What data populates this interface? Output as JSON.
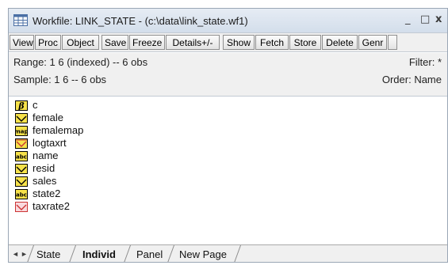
{
  "window": {
    "title": "Workfile: LINK_STATE - (c:\\data\\link_state.wf1)",
    "controls": {
      "minimize": "_",
      "maximize": "□",
      "close": "x"
    }
  },
  "toolbar": [
    "View",
    "Proc",
    "Object",
    "Save",
    "Freeze",
    "Details+/-",
    "Show",
    "Fetch",
    "Store",
    "Delete",
    "Genr"
  ],
  "info": {
    "range": "Range:  1 6 (indexed)  --  6 obs",
    "sample": "Sample: 1 6  --  6 obs",
    "filter": "Filter: *",
    "order": "Order: Name"
  },
  "objects": [
    {
      "name": "c",
      "icon": "coef-icon"
    },
    {
      "name": "female",
      "icon": "series-icon"
    },
    {
      "name": "femalemap",
      "icon": "map-icon"
    },
    {
      "name": "logtaxrt",
      "icon": "link-series-icon"
    },
    {
      "name": "name",
      "icon": "alpha-icon"
    },
    {
      "name": "resid",
      "icon": "series-icon"
    },
    {
      "name": "sales",
      "icon": "series-icon"
    },
    {
      "name": "state2",
      "icon": "alpha-icon"
    },
    {
      "name": "taxrate2",
      "icon": "link-series-red-icon"
    }
  ],
  "tabs": {
    "left_arrow": "◄",
    "right_arrow": "►",
    "items": [
      "State",
      "Individ",
      "Panel",
      "New Page"
    ],
    "active": "Individ"
  },
  "icon_glyphs": {
    "coef": "β",
    "map": "map",
    "alpha": "abc"
  },
  "colors": {
    "series_yellow": "#f7e24a",
    "link_red": "#cc3333",
    "title_bg": "#dbe4ef"
  }
}
